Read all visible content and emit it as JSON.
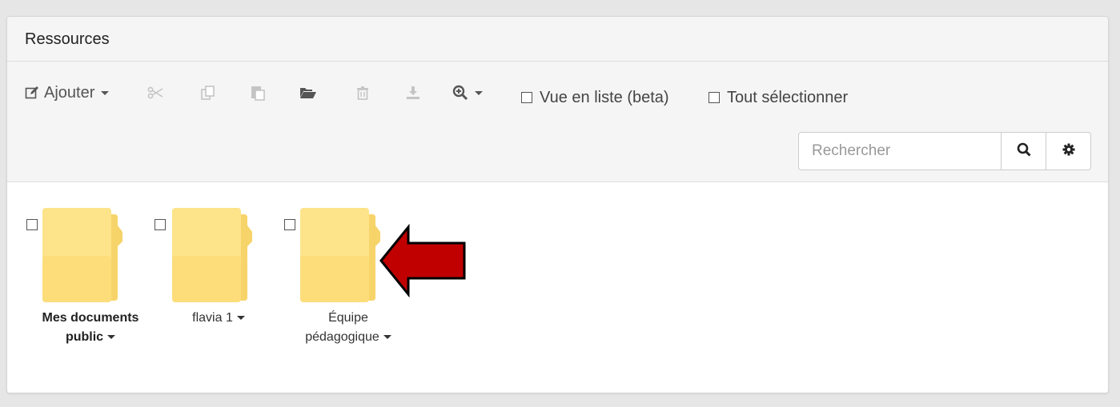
{
  "panel": {
    "title": "Ressources"
  },
  "toolbar": {
    "add_label": "Ajouter",
    "list_view_label": "Vue en liste (beta)",
    "select_all_label": "Tout sélectionner"
  },
  "search": {
    "placeholder": "Rechercher"
  },
  "folders": [
    {
      "line1": "Mes documents",
      "line2": "public",
      "bold": true
    },
    {
      "line1": "flavia 1",
      "line2": "",
      "bold": false
    },
    {
      "line1": "Équipe",
      "line2": "pédagogique",
      "bold": false
    }
  ],
  "colors": {
    "folder_front": "#fde38a",
    "folder_back": "#f7d46a",
    "arrow": "#c00000",
    "panel_bg": "#f5f5f5"
  }
}
